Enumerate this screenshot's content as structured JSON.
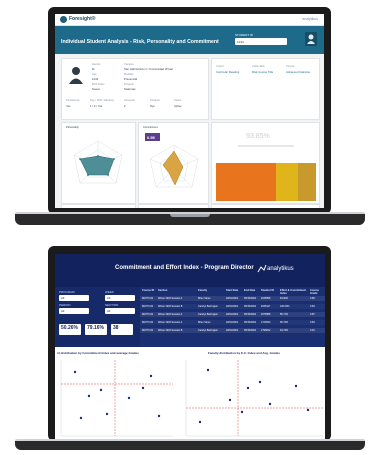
{
  "screen1": {
    "logo_text": "Foresight®",
    "brand": "analytikus",
    "header_title": "Individual Student Analysis - Risk, Personality and Commitment",
    "student_id_label": "STUDENT ID",
    "student_id_value": "1234",
    "profile": {
      "labels": [
        "Gender",
        "Age",
        "Birth Place",
        "Persistence",
        "Day / Shift / Ethnicity",
        "Semester",
        "Program",
        "Status"
      ],
      "values": [
        "M",
        "1234",
        "Nuevo",
        "Yes",
        "1 / 2 / Yes",
        "2",
        "Sys",
        "Active"
      ],
      "mid_labels": [
        "Campus",
        "Modality",
        "Program"
      ],
      "mid_values": [
        "San Gabriel Edu 1 / Universidad Virtual",
        "Presencial",
        "Sistemas"
      ]
    },
    "performance": {
      "labels": [
        "Cohort",
        "Latest Risk",
        "Course"
      ],
      "values": [
        "Curricular Reading",
        "Risk Course Title",
        "Advanced Calculus"
      ]
    },
    "radar1_title": "Personality",
    "radar2_title": "Commitment",
    "radar2_value": "0.59",
    "gauge_value": "93.85%",
    "colors": {
      "header": "#1d6a8a",
      "radar_teal": "#4e8f97",
      "radar_gold": "#d9a441",
      "kpi_purple": "#5a3e8c",
      "heat_orange": "#e8741d",
      "heat_yellow": "#e0b41b",
      "heat_gold": "#c89a2e"
    }
  },
  "screen2": {
    "title": "Commitment and Effort Index - Program Director",
    "brand": "analytikus",
    "filters": {
      "program_label": "PROGRAM",
      "week_label": "WEEK",
      "period_label": "PERIOD",
      "section_label": "SECTION",
      "program_value": "All",
      "week_value": "All",
      "period_value": "All",
      "section_value": "All"
    },
    "kpis": [
      "50.26%",
      "79.16%",
      "38"
    ],
    "table": {
      "headers": [
        "Course ID",
        "Section",
        "Faculty",
        "Start Date",
        "End Date",
        "Student ID",
        "Effort & Commitment Index",
        "Course Grade"
      ],
      "rows": [
        [
          "MATH 101",
          "Winter 2019 Session A",
          "Brian Stone",
          "02/01/2019",
          "05/15/2019",
          "2045558",
          "84.90%",
          "0.86"
        ],
        [
          "MATH 101",
          "Winter 2019 Session B",
          "Carolyn Barrington",
          "02/01/2019",
          "05/15/2019",
          "2045127",
          "100.00%",
          "0.83"
        ],
        [
          "MATH 101",
          "Winter 2019 Session A",
          "Carolyn Barrington",
          "02/01/2019",
          "05/15/2019",
          "2075588",
          "85.71%",
          "0.87"
        ],
        [
          "MATH 101",
          "Winter 2019 Session A",
          "Brian Stone",
          "02/01/2019",
          "05/15/2019",
          "1723523",
          "95.74%",
          "0.83"
        ],
        [
          "MATH 101",
          "Winter 2019 Session B",
          "Carolyn Barrington",
          "02/01/2019",
          "05/15/2019",
          "1796812",
          "94.74%",
          "0.91"
        ]
      ]
    },
    "scatter1_title": "nt distribution by Commitment Index and average Grades",
    "scatter2_title": "Faculty distribution by E.C. Index and Avg. Grades",
    "colors": {
      "navy": "#12225e",
      "panel": "#162a6a",
      "table": "#1a2f72",
      "refline": "#e34a4a"
    }
  }
}
